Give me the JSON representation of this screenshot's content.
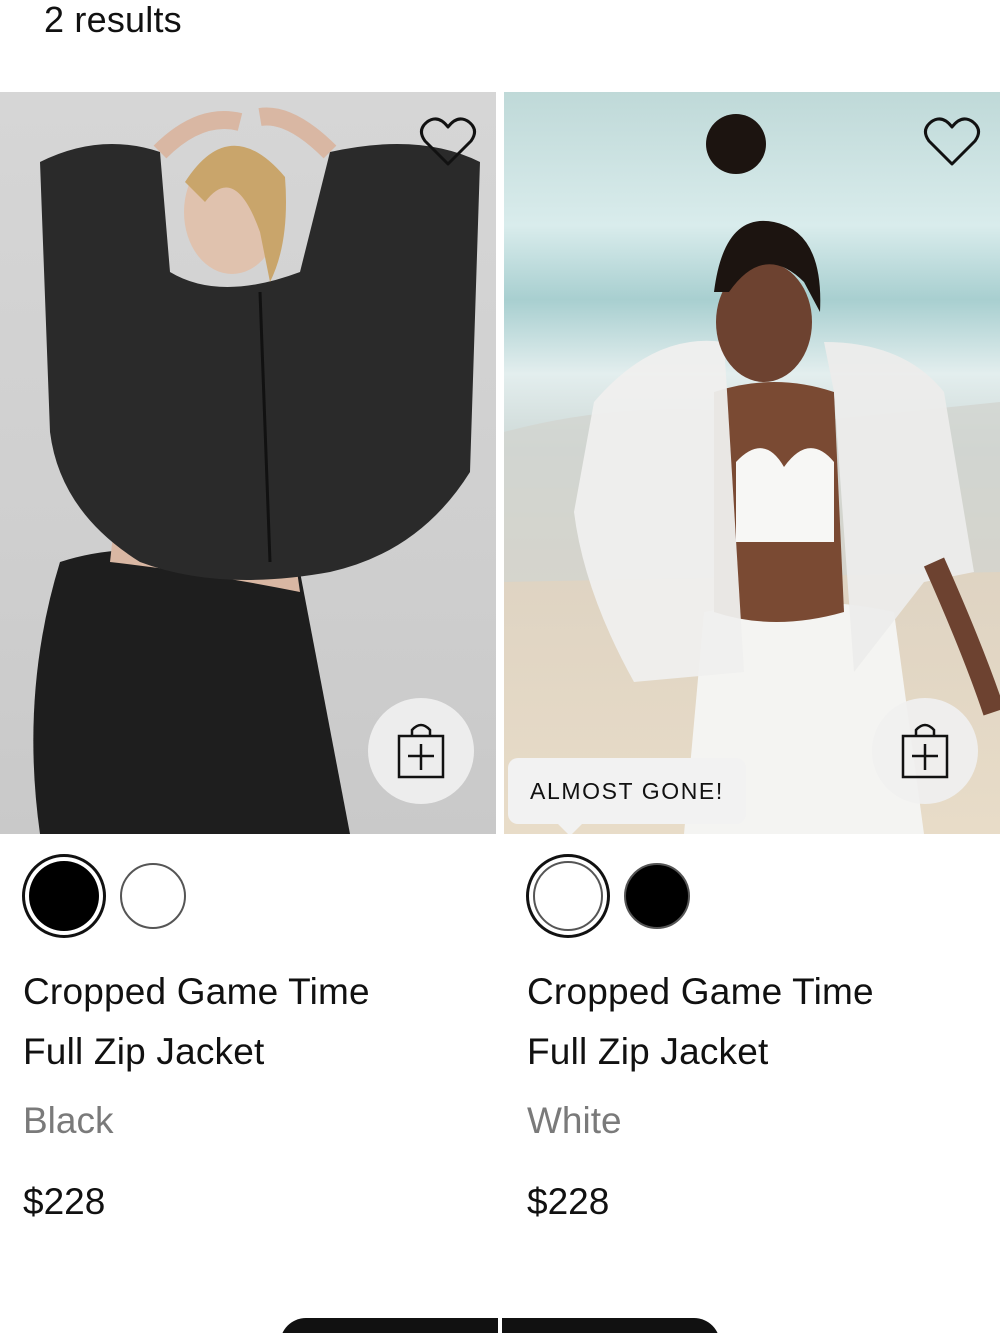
{
  "results": {
    "label": "2 results"
  },
  "products": [
    {
      "title_line1": "Cropped Game Time",
      "title_line2": "Full Zip Jacket",
      "color": "Black",
      "price": "$228",
      "badge": "",
      "swatches": [
        {
          "color": "#000000",
          "selected": true
        },
        {
          "color": "#ffffff",
          "selected": false
        }
      ]
    },
    {
      "title_line1": "Cropped Game Time",
      "title_line2": "Full Zip Jacket",
      "color": "White",
      "price": "$228",
      "badge": "ALMOST GONE!",
      "swatches": [
        {
          "color": "#ffffff",
          "selected": true
        },
        {
          "color": "#000000",
          "selected": false
        }
      ]
    }
  ],
  "icons": {
    "wishlist": "heart-icon",
    "add_to_bag": "shopping-bag-plus-icon"
  }
}
